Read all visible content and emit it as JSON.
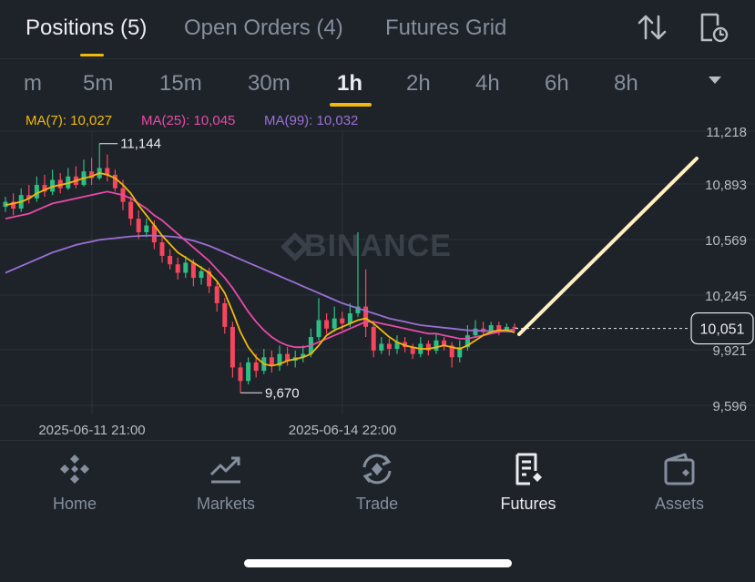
{
  "top_tabs": {
    "positions": "Positions (5)",
    "open_orders": "Open Orders (4)",
    "futures_grid": "Futures Grid"
  },
  "intervals": [
    "m",
    "5m",
    "15m",
    "30m",
    "1h",
    "2h",
    "4h",
    "6h",
    "8h"
  ],
  "active_interval": "1h",
  "ma": {
    "ma7_label": "MA(7): 10,027",
    "ma25_label": "MA(25): 10,045",
    "ma99_label": "MA(99): 10,032",
    "ma7_color": "#f0b90b",
    "ma25_color": "#e84aa8",
    "ma99_color": "#9b6fd6"
  },
  "watermark": "BINANCE",
  "chart_data": {
    "type": "candlestick",
    "y_ticks": [
      "11,218",
      "10,893",
      "10,569",
      "10,245",
      "9,921",
      "9,596"
    ],
    "x_labels": [
      "2025-06-11 21:00",
      "2025-06-14 22:00"
    ],
    "high_label": "11,144",
    "low_label": "9,670",
    "current_price": "10,051",
    "candles": [
      [
        10770,
        10800,
        10830,
        10740
      ],
      [
        10800,
        10760,
        10850,
        10720
      ],
      [
        10760,
        10840,
        10880,
        10740
      ],
      [
        10840,
        10820,
        10900,
        10790
      ],
      [
        10820,
        10900,
        10950,
        10800
      ],
      [
        10900,
        10860,
        10960,
        10830
      ],
      [
        10860,
        10930,
        10990,
        10840
      ],
      [
        10930,
        10880,
        10970,
        10850
      ],
      [
        10880,
        10950,
        11000,
        10870
      ],
      [
        10950,
        10900,
        11010,
        10880
      ],
      [
        10900,
        10980,
        11050,
        10890
      ],
      [
        10980,
        10940,
        11060,
        10900
      ],
      [
        10940,
        11000,
        11144,
        10930
      ],
      [
        11000,
        10960,
        11080,
        10920
      ],
      [
        10960,
        10880,
        10990,
        10860
      ],
      [
        10880,
        10800,
        10930,
        10750
      ],
      [
        10800,
        10700,
        10830,
        10660
      ],
      [
        10700,
        10620,
        10750,
        10580
      ],
      [
        10620,
        10660,
        10700,
        10590
      ],
      [
        10660,
        10560,
        10690,
        10520
      ],
      [
        10560,
        10480,
        10600,
        10440
      ],
      [
        10480,
        10430,
        10520,
        10400
      ],
      [
        10430,
        10380,
        10470,
        10340
      ],
      [
        10380,
        10440,
        10480,
        10350
      ],
      [
        10440,
        10350,
        10460,
        10300
      ],
      [
        10350,
        10390,
        10420,
        10310
      ],
      [
        10390,
        10300,
        10410,
        10260
      ],
      [
        10300,
        10200,
        10330,
        10150
      ],
      [
        10200,
        10060,
        10230,
        10020
      ],
      [
        10060,
        9820,
        10090,
        9760
      ],
      [
        9820,
        9740,
        9850,
        9670
      ],
      [
        9740,
        9850,
        9880,
        9720
      ],
      [
        9850,
        9800,
        9900,
        9760
      ],
      [
        9800,
        9880,
        9930,
        9780
      ],
      [
        9880,
        9830,
        9920,
        9790
      ],
      [
        9830,
        9900,
        9950,
        9800
      ],
      [
        9900,
        9860,
        9940,
        9830
      ],
      [
        9860,
        9880,
        9920,
        9820
      ],
      [
        9880,
        9900,
        9950,
        9850
      ],
      [
        9900,
        10000,
        10050,
        9880
      ],
      [
        10000,
        10100,
        10230,
        9980
      ],
      [
        10100,
        10050,
        10140,
        10020
      ],
      [
        10050,
        10110,
        10180,
        10030
      ],
      [
        10110,
        10080,
        10150,
        10040
      ],
      [
        10080,
        10140,
        10200,
        10060
      ],
      [
        10140,
        10180,
        10620,
        10120
      ],
      [
        10180,
        10060,
        10400,
        10000
      ],
      [
        10060,
        9920,
        10090,
        9880
      ],
      [
        9920,
        9960,
        10000,
        9900
      ],
      [
        9960,
        9930,
        9990,
        9890
      ],
      [
        9930,
        9970,
        10010,
        9900
      ],
      [
        9970,
        9940,
        10000,
        9910
      ],
      [
        9940,
        9900,
        9960,
        9870
      ],
      [
        9900,
        9960,
        10000,
        9880
      ],
      [
        9960,
        9920,
        9980,
        9890
      ],
      [
        9920,
        9980,
        10020,
        9900
      ],
      [
        9980,
        9950,
        10000,
        9920
      ],
      [
        9950,
        9880,
        9970,
        9820
      ],
      [
        9880,
        9940,
        9980,
        9850
      ],
      [
        9940,
        10010,
        10070,
        9920
      ],
      [
        10010,
        10050,
        10100,
        10000
      ],
      [
        10050,
        10030,
        10090,
        10010
      ],
      [
        10030,
        10070,
        10090,
        10020
      ],
      [
        10070,
        10040,
        10090,
        10010
      ],
      [
        10040,
        10060,
        10080,
        10030
      ],
      [
        10060,
        10051,
        10080,
        10030
      ]
    ],
    "ma7": [
      10780,
      10790,
      10800,
      10820,
      10850,
      10870,
      10890,
      10900,
      10910,
      10925,
      10940,
      10950,
      10970,
      10960,
      10940,
      10900,
      10850,
      10780,
      10720,
      10660,
      10600,
      10550,
      10500,
      10470,
      10440,
      10410,
      10380,
      10330,
      10260,
      10150,
      10030,
      9940,
      9880,
      9840,
      9830,
      9840,
      9860,
      9870,
      9880,
      9900,
      9950,
      10010,
      10040,
      10060,
      10080,
      10100,
      10110,
      10080,
      10040,
      10000,
      9970,
      9950,
      9940,
      9930,
      9930,
      9940,
      9950,
      9940,
      9930,
      9950,
      9980,
      10010,
      10030,
      10040,
      10040,
      10027
    ],
    "ma25": [
      10700,
      10710,
      10720,
      10730,
      10750,
      10770,
      10790,
      10800,
      10810,
      10820,
      10830,
      10840,
      10850,
      10860,
      10850,
      10840,
      10820,
      10790,
      10760,
      10720,
      10690,
      10650,
      10610,
      10570,
      10530,
      10490,
      10450,
      10400,
      10350,
      10290,
      10220,
      10150,
      10090,
      10040,
      10000,
      9970,
      9950,
      9940,
      9940,
      9950,
      9970,
      9990,
      10010,
      10030,
      10050,
      10070,
      10090,
      10090,
      10080,
      10070,
      10060,
      10050,
      10040,
      10030,
      10020,
      10020,
      10010,
      10000,
      9990,
      9990,
      10000,
      10010,
      10020,
      10030,
      10040,
      10045
    ],
    "ma99": [
      10380,
      10400,
      10420,
      10440,
      10460,
      10480,
      10500,
      10515,
      10530,
      10545,
      10555,
      10565,
      10575,
      10580,
      10585,
      10590,
      10595,
      10598,
      10600,
      10600,
      10598,
      10595,
      10590,
      10580,
      10570,
      10555,
      10540,
      10520,
      10500,
      10480,
      10460,
      10440,
      10420,
      10400,
      10380,
      10360,
      10340,
      10320,
      10300,
      10280,
      10260,
      10240,
      10220,
      10200,
      10185,
      10170,
      10155,
      10140,
      10125,
      10110,
      10100,
      10090,
      10080,
      10070,
      10065,
      10060,
      10055,
      10050,
      10045,
      10040,
      10038,
      10036,
      10035,
      10034,
      10033,
      10032
    ]
  },
  "nav": {
    "home": "Home",
    "markets": "Markets",
    "trade": "Trade",
    "futures": "Futures",
    "assets": "Assets"
  },
  "colors": {
    "accent": "#f0b90b",
    "up": "#2ebd85",
    "down": "#f6465d",
    "background": "#1e2329"
  }
}
